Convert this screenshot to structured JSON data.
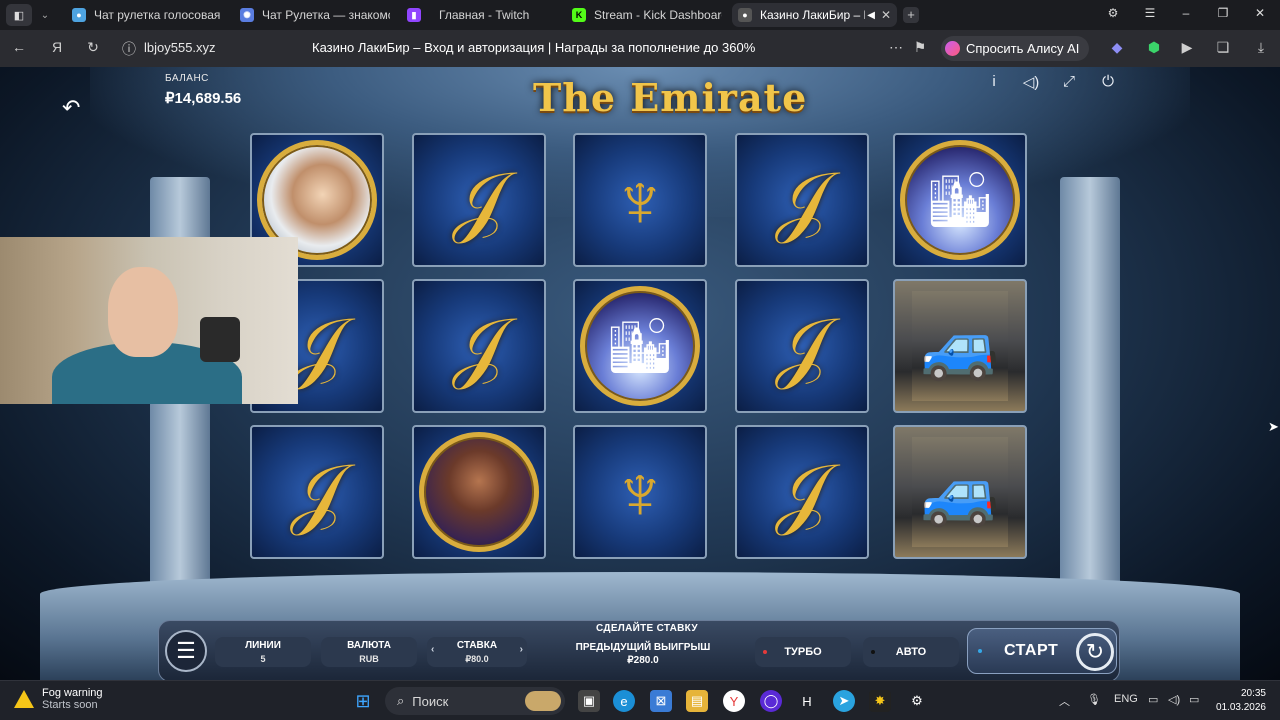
{
  "browser": {
    "tabs": [
      {
        "title": "Чат рулетка голосовая –",
        "favicon": "chat-icon",
        "color": "#4ea3e0"
      },
      {
        "title": "Чат Рулетка — знакомств",
        "favicon": "globe-icon",
        "color": "#5a7de0"
      },
      {
        "title": "Главная - Twitch",
        "favicon": "twitch-icon",
        "color": "#9146ff"
      },
      {
        "title": "Stream - Kick Dashboard",
        "favicon": "kick-icon",
        "color": "#53fc18"
      },
      {
        "title": "Казино ЛакиБир – В",
        "favicon": "casino-icon",
        "color": "#888888",
        "active": true
      }
    ],
    "domain": "lbjoy555.xyz",
    "page_title": "Казино ЛакиБир – Вход и авторизация | Награды за пополнение до 360%",
    "alisa_label": "Спросить Алису AI"
  },
  "game": {
    "title": "The Emirate",
    "balance_label": "БАЛАНС",
    "balance_value": "₽14,689.56",
    "reels": [
      [
        "sheikh",
        "dagger",
        "dagger"
      ],
      [
        "dagger",
        "dagger",
        "woman"
      ],
      [
        "hookah",
        "city",
        "hookah"
      ],
      [
        "dagger",
        "dagger",
        "dagger"
      ],
      [
        "city",
        "truck",
        "truck"
      ]
    ],
    "controls": {
      "make_bet": "СДЕЛАЙТЕ СТАВКУ",
      "lines_label": "ЛИНИИ",
      "lines_value": "5",
      "currency_label": "ВАЛЮТА",
      "currency_value": "RUB",
      "bet_label": "СТАВКА",
      "bet_value": "₽80.0",
      "prev_win_label": "ПРЕДЫДУЩИЙ ВЫИГРЫШ",
      "prev_win_value": "₽280.0",
      "turbo_label": "ТУРБО",
      "auto_label": "АВТО",
      "start_label": "СТАРТ"
    }
  },
  "taskbar": {
    "weather_title": "Fog warning",
    "weather_sub": "Starts soon",
    "search_placeholder": "Поиск",
    "lang": "ENG",
    "time": "20:35",
    "date": "01.03.2026"
  }
}
